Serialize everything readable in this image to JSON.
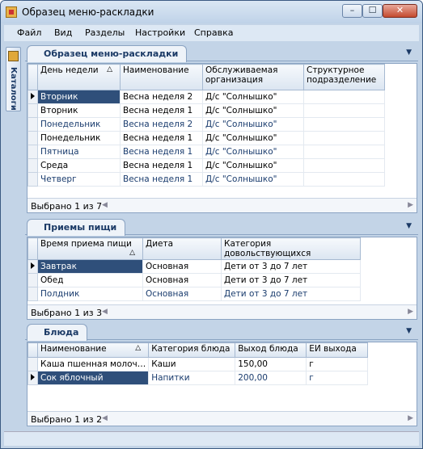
{
  "window": {
    "title": "Образец меню-раскладки",
    "min": "–",
    "max": "☐",
    "close": "✕"
  },
  "menu": [
    "Файл",
    "Вид",
    "Разделы",
    "Настройки",
    "Справка"
  ],
  "sidebar": {
    "tab": "Каталоги"
  },
  "panel1": {
    "tab": "Образец меню-раскладки",
    "headers": [
      "День недели",
      "Наименование",
      "Обслуживаемая организация",
      "Структурное подразделение"
    ],
    "rows": [
      [
        "Вторник",
        "Весна неделя 2",
        "Д/с \"Солнышко\"",
        ""
      ],
      [
        "Вторник",
        "Весна неделя 1",
        "Д/с \"Солнышко\"",
        ""
      ],
      [
        "Понедельник",
        "Весна неделя 2",
        "Д/с \"Солнышко\"",
        ""
      ],
      [
        "Понедельник",
        "Весна неделя 1",
        "Д/с \"Солнышко\"",
        ""
      ],
      [
        "Пятница",
        "Весна неделя 1",
        "Д/с \"Солнышко\"",
        ""
      ],
      [
        "Среда",
        "Весна неделя 1",
        "Д/с \"Солнышко\"",
        ""
      ],
      [
        "Четверг",
        "Весна неделя 1",
        "Д/с \"Солнышко\"",
        ""
      ]
    ],
    "footer": "Выбрано 1 из 7"
  },
  "panel2": {
    "tab": "Приемы пищи",
    "headers": [
      "Время приема пищи",
      "Диета",
      "Категория довольствующихся"
    ],
    "rows": [
      [
        "Завтрак",
        "Основная",
        "Дети от 3 до 7 лет"
      ],
      [
        "Обед",
        "Основная",
        "Дети от 3 до 7 лет"
      ],
      [
        "Полдник",
        "Основная",
        "Дети от 3 до 7 лет"
      ]
    ],
    "footer": "Выбрано 1 из 3"
  },
  "panel3": {
    "tab": "Блюда",
    "headers": [
      "Наименование",
      "Категория блюда",
      "Выход блюда",
      "ЕИ выхода"
    ],
    "rows": [
      [
        "Каша пшенная молоч…",
        "Каши",
        "150,00",
        "г"
      ],
      [
        "Сок яблочный",
        "Напитки",
        "200,00",
        "г"
      ]
    ],
    "footer": "Выбрано 1 из 2"
  }
}
